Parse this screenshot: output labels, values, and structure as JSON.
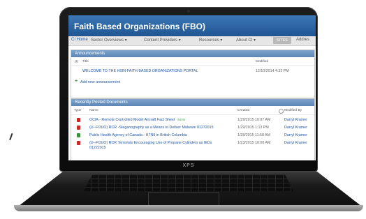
{
  "portal": {
    "title": "Faith Based Organizations (FBO)",
    "nav": [
      "CI Home",
      "Sector Overviews ▾",
      "Content Providers ▾",
      "Resources ▾",
      "About CI ▾",
      "SITES",
      "Addres"
    ]
  },
  "announcements": {
    "header": "Announcements",
    "col_title": "Title",
    "col_modified": "Modified",
    "items": [
      {
        "title": "WELCOME TO THE HSIN-FAITH BASED ORGANIZATIONS PORTAL",
        "modified": "12/10/2014 4:32 PM"
      }
    ],
    "add_label": "Add new announcement"
  },
  "documents": {
    "header": "Recently Posted Documents",
    "col_type": "Type",
    "col_name": "Name",
    "col_created": "Created",
    "col_modified_by": "Modified By",
    "items": [
      {
        "name": "OCIA - Remote Controlled Model Aircraft Fact Sheet",
        "new": "!NEW",
        "created": "1/29/2015 10:07 AM",
        "by": "Darryl Kramer"
      },
      {
        "name": "(U--FOUO) RCR -Steganography as a Means to Deliver Malware 01272015",
        "new": "",
        "created": "1/29/2015 1:13 PM",
        "by": "Darryl Kramer"
      },
      {
        "name": "Public Health Agency of Canada - H7N9 in British Columbia",
        "new": "",
        "created": "1/28/2015 11:58 AM",
        "by": "Darryl Kramer"
      },
      {
        "name": "(U--FOUO) RCR Terrorists Encouraging Use of Propane Cylinders as IEDs",
        "name2": "01222015",
        "new": "",
        "created": "1/23/2015 10:00 AM",
        "by": "Darryl Kramer"
      }
    ]
  },
  "laptop": {
    "brand": "XPS"
  }
}
